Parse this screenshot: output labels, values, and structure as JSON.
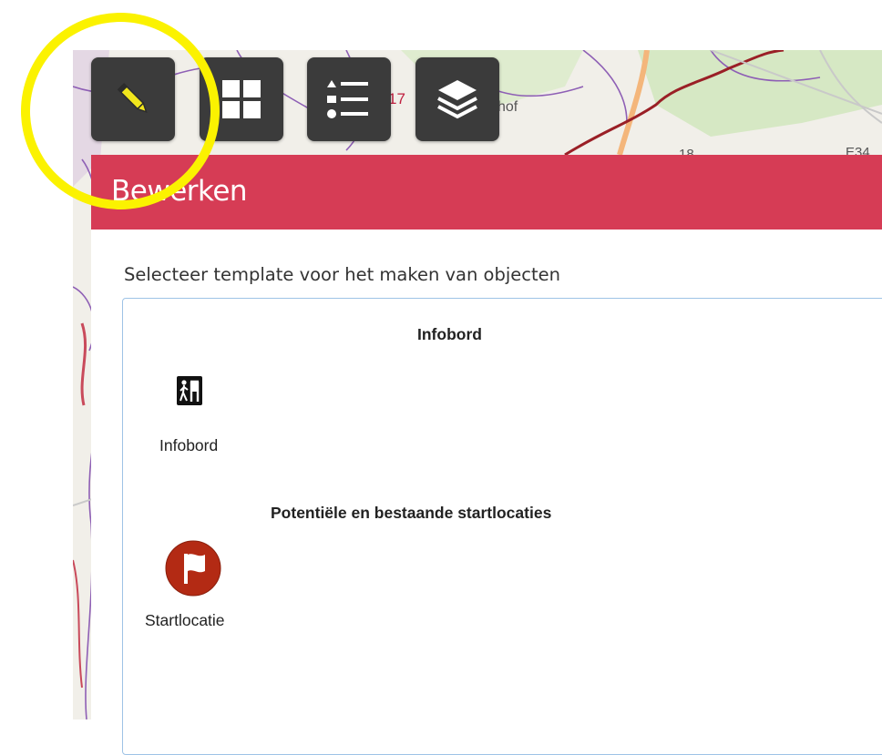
{
  "toolbar": {
    "buttons": [
      {
        "icon": "pencil-icon",
        "label": "Bewerken"
      },
      {
        "icon": "grid-icon",
        "label": ""
      },
      {
        "icon": "list-icon",
        "label": ""
      },
      {
        "icon": "layers-icon",
        "label": ""
      }
    ]
  },
  "map_labels": {
    "road_number_1": "17",
    "place_fragment": "hof",
    "road_number_2": "18",
    "road_number_3": "E34"
  },
  "panel": {
    "title": "Bewerken",
    "instruction": "Selecteer template voor het maken van objecten",
    "groups": [
      {
        "title": "Infobord",
        "templates": [
          {
            "label": "Infobord",
            "icon": "hiker-board-icon"
          }
        ]
      },
      {
        "title": "Potentiële en bestaande startlocaties",
        "templates": [
          {
            "label": "Startlocatie",
            "icon": "flag-icon"
          }
        ]
      }
    ]
  },
  "colors": {
    "header": "#d63c55",
    "toolbar_button": "#3b3b3b",
    "pencil": "#f1e61c",
    "highlight_circle": "#fbf200",
    "flag_icon": "#b32a14"
  }
}
